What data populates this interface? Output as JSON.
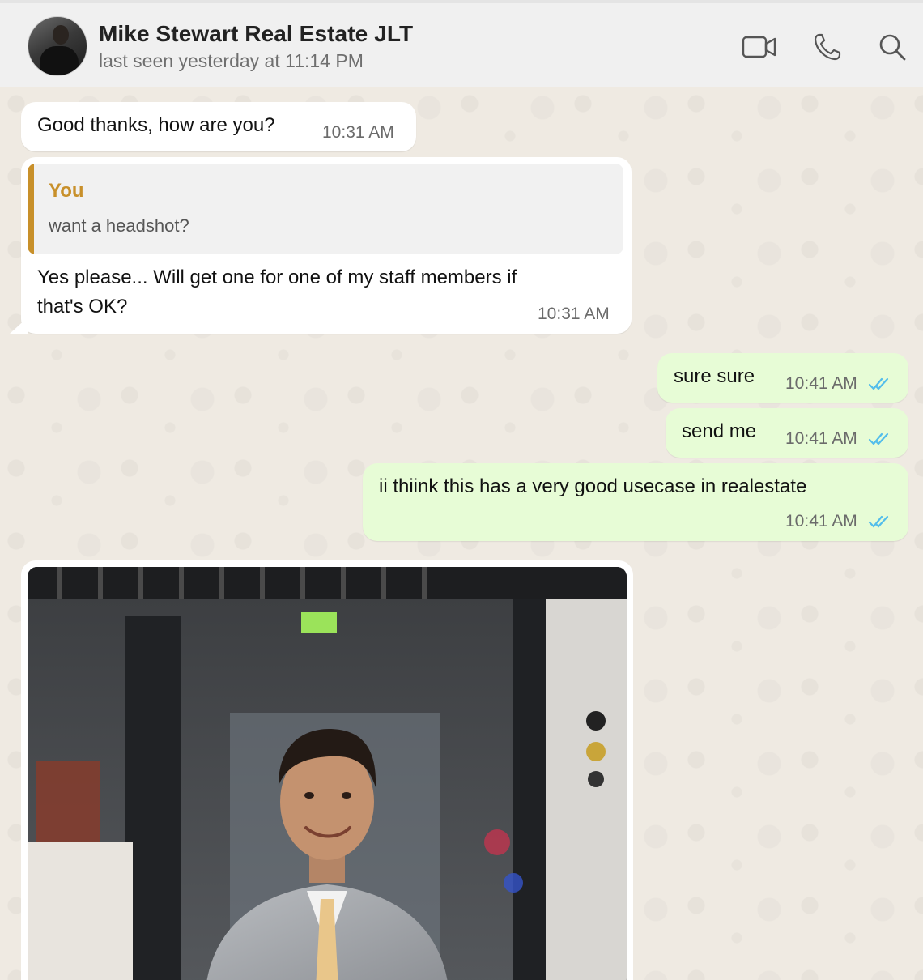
{
  "header": {
    "contact_name": "Mike Stewart Real Estate JLT",
    "status": "last seen yesterday at 11:14 PM",
    "icons": [
      "video-call-icon",
      "voice-call-icon",
      "search-icon"
    ]
  },
  "messages": [
    {
      "direction": "incoming",
      "text": "Good thanks, how are you?",
      "time": "10:31 AM"
    },
    {
      "direction": "incoming",
      "quote": {
        "author": "You",
        "text": "want a headshot?"
      },
      "text_line1": "Yes please... Will get one for one of my staff members if",
      "text_line2": "that's OK?",
      "time": "10:31 AM"
    },
    {
      "direction": "outgoing",
      "text": "sure sure",
      "time": "10:41 AM",
      "status": "read"
    },
    {
      "direction": "outgoing",
      "text": "send me",
      "time": "10:41 AM",
      "status": "read"
    },
    {
      "direction": "outgoing",
      "text": "ii thiink this has a very good usecase in realestate",
      "time": "10:41 AM",
      "status": "read"
    },
    {
      "direction": "incoming",
      "type": "image"
    }
  ],
  "colors": {
    "incoming_bubble": "#ffffff",
    "outgoing_bubble": "#e7fcd6",
    "read_ticks": "#53bdeb",
    "quote_accent": "#c8902a",
    "header_bg": "#f0f0f0",
    "chat_bg": "#efeae2"
  }
}
